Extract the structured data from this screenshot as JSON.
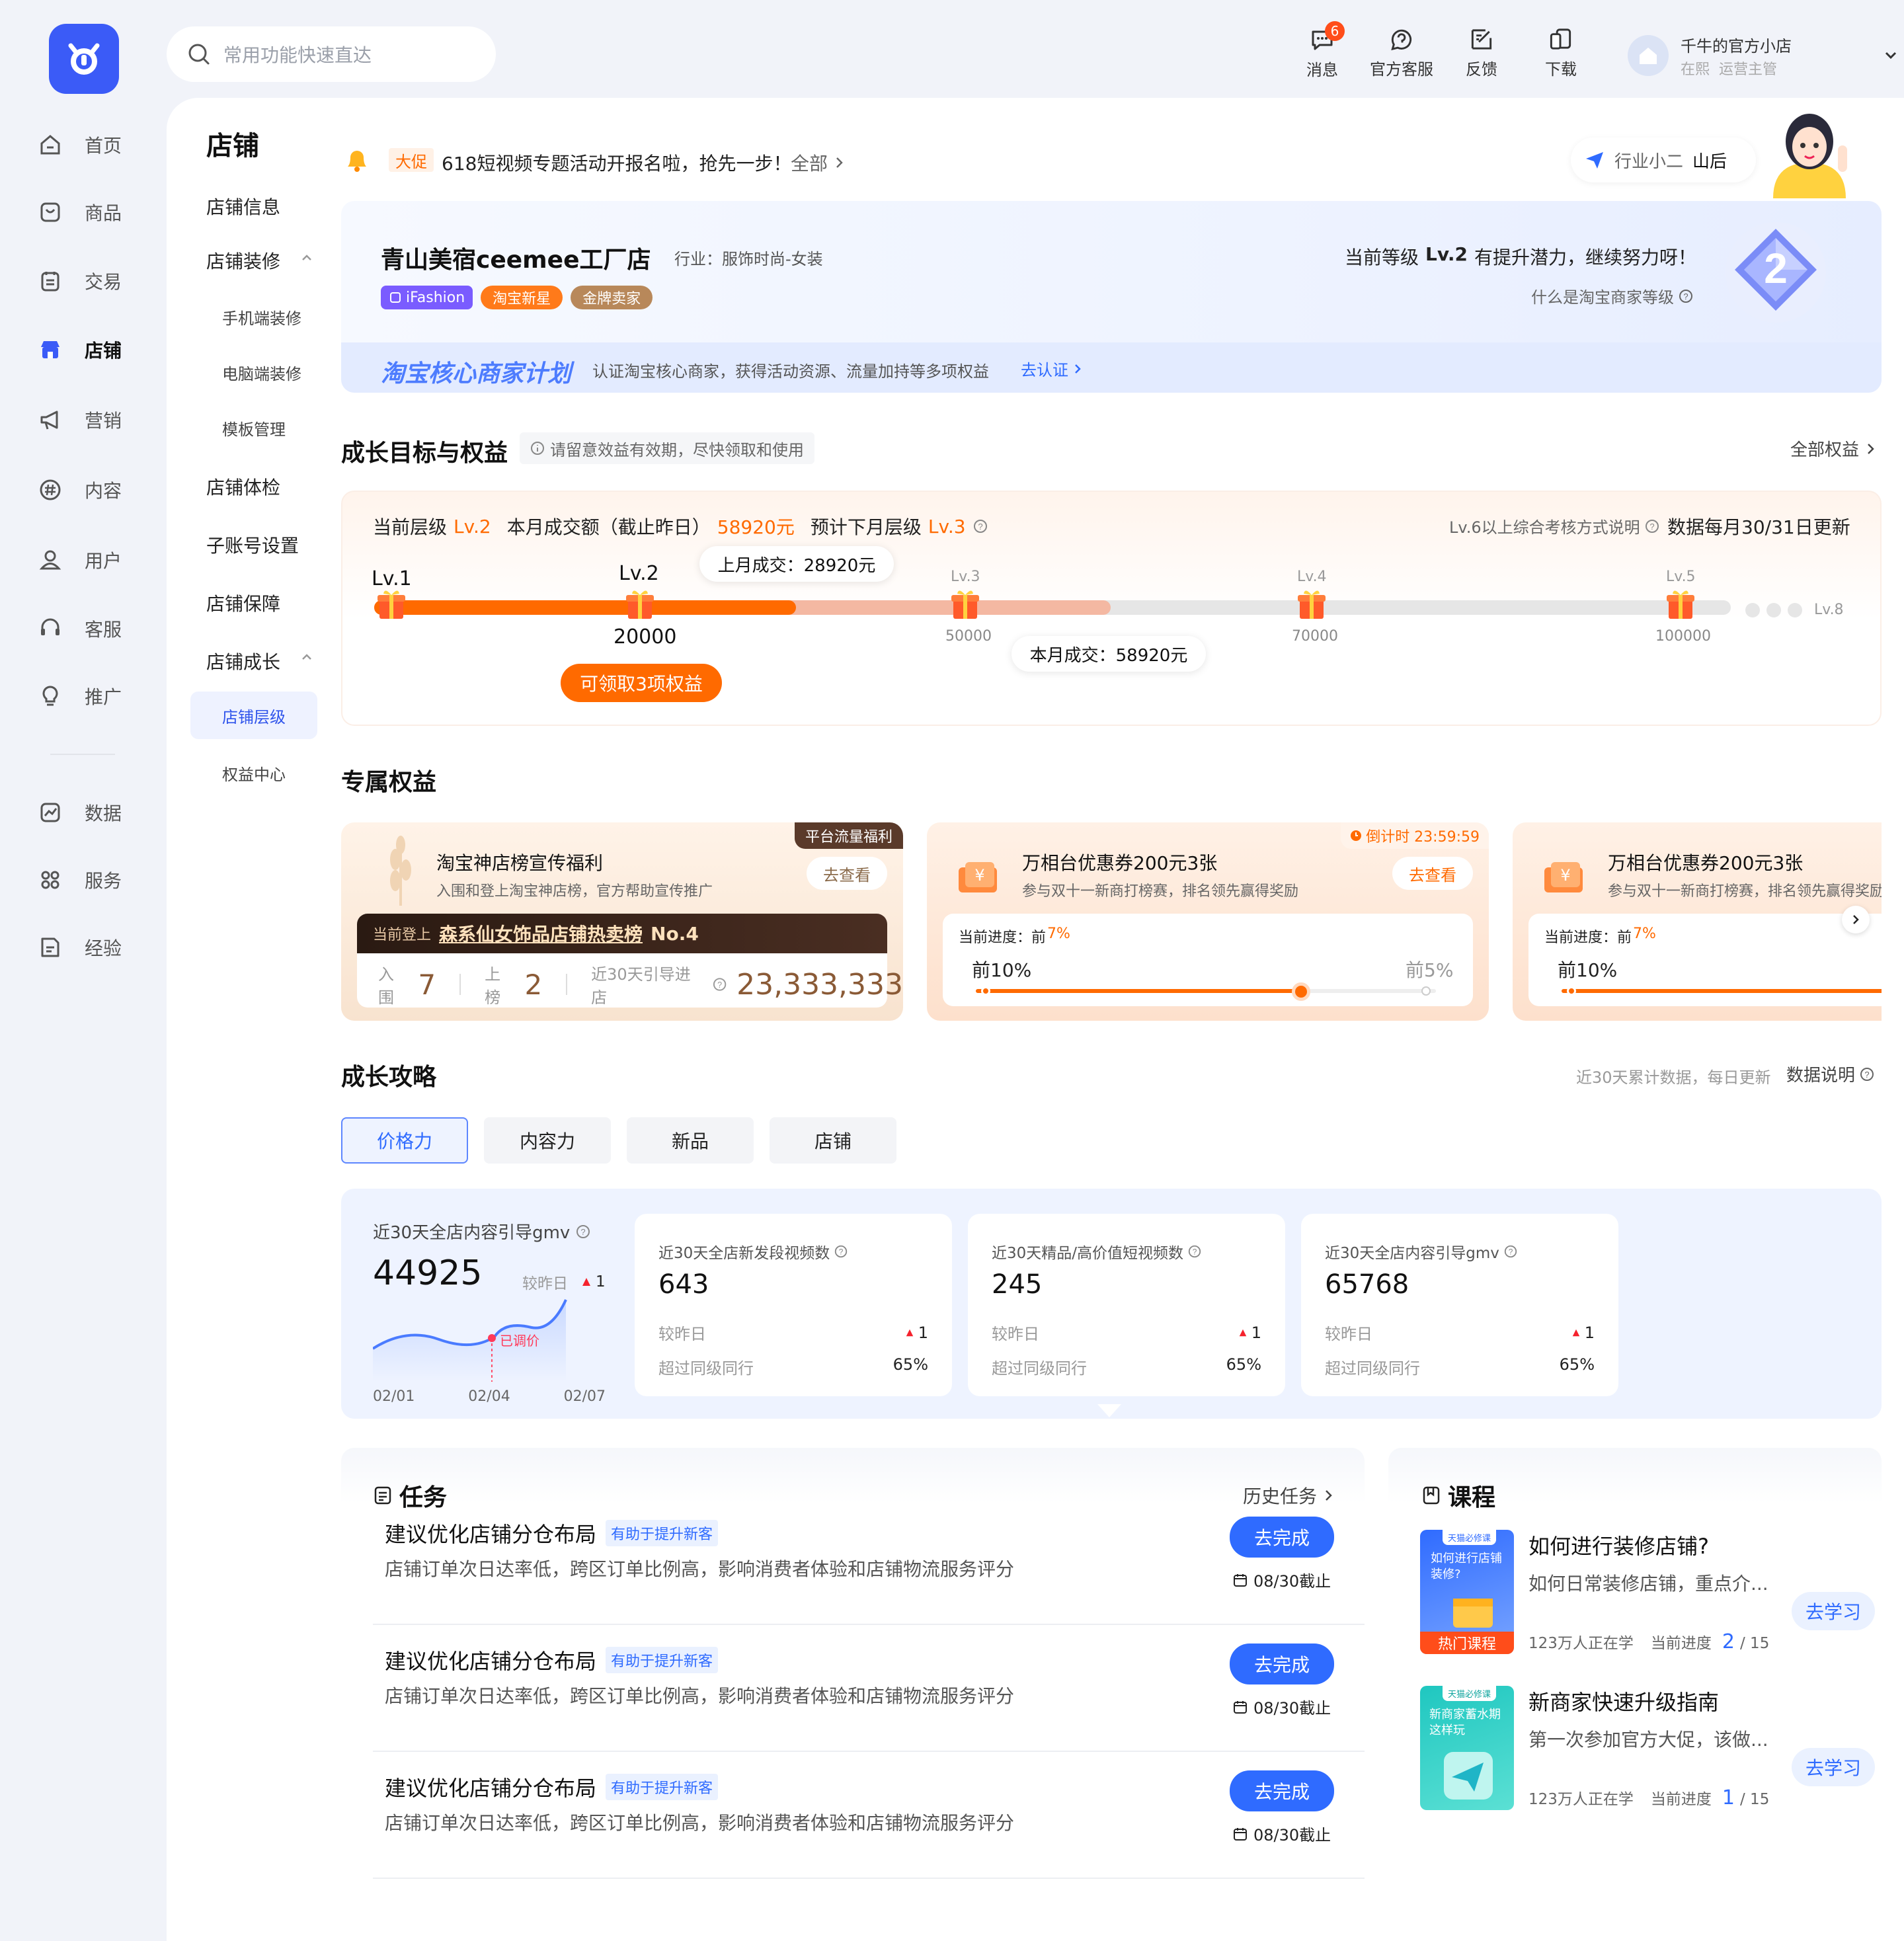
{
  "header": {
    "search_placeholder": "常用功能快速直达",
    "icons": [
      {
        "label": "消息",
        "badge": "6"
      },
      {
        "label": "官方客服"
      },
      {
        "label": "反馈"
      },
      {
        "label": "下载"
      }
    ],
    "user": {
      "name": "千牛的官方小店",
      "status": "在熙",
      "role": "运营主管"
    }
  },
  "sidebar": {
    "items": [
      {
        "label": "首页"
      },
      {
        "label": "商品"
      },
      {
        "label": "交易"
      },
      {
        "label": "店铺"
      },
      {
        "label": "营销"
      },
      {
        "label": "内容"
      },
      {
        "label": "用户"
      },
      {
        "label": "客服"
      },
      {
        "label": "推广"
      },
      {
        "label": "数据"
      },
      {
        "label": "服务"
      },
      {
        "label": "经验"
      }
    ],
    "active": "店铺"
  },
  "subnav": {
    "title": "店铺",
    "items": [
      "店铺信息",
      "店铺装修",
      "手机端装修",
      "电脑端装修",
      "模板管理",
      "店铺体检",
      "子账号设置",
      "店铺保障",
      "店铺成长",
      "店铺层级",
      "权益中心"
    ]
  },
  "notice": {
    "tag": "大促",
    "text": "618短视频专题活动开报名啦，抢先一步！",
    "link": "全部"
  },
  "assistant": {
    "label": "行业小二",
    "name": "山后"
  },
  "shop": {
    "name": "青山美宿ceemee工厂店",
    "industry": "行业：服饰时尚-女装",
    "tags": [
      "iFashion",
      "淘宝新星",
      "金牌卖家"
    ],
    "level_text_prefix": "当前等级",
    "level": "Lv.2",
    "level_text_suffix": "有提升潜力，继续努力呀！",
    "level_help": "什么是淘宝商家等级",
    "level_badge": "2",
    "plan_title": "淘宝核心商家计划",
    "plan_desc": "认证淘宝核心商家，获得活动资源、流量加持等多项权益",
    "plan_link": "去认证"
  },
  "growth": {
    "title": "成长目标与权益",
    "tip": "请留意效益有效期，尽快领取和使用",
    "all_link": "全部权益",
    "current_label": "当前层级",
    "current_level": "Lv.2",
    "month_label": "本月成交额（截止昨日）",
    "month_amount": "58920元",
    "next_label": "预计下月层级",
    "next_level": "Lv.3",
    "note": "Lv.6以上综合考核方式说明",
    "update": "数据每月30/31日更新",
    "last_month_bubble": "上月成交：28920元",
    "this_month_bubble": "本月成交：58920元",
    "claim_button": "可领取3项权益",
    "levels": [
      {
        "name": "Lv.1",
        "value": ""
      },
      {
        "name": "Lv.2",
        "value": "20000"
      },
      {
        "name": "Lv.3",
        "value": "50000"
      },
      {
        "name": "Lv.4",
        "value": "70000"
      },
      {
        "name": "Lv.5",
        "value": "100000"
      }
    ],
    "end_level": "Lv.8",
    "last_month_value": 28920,
    "this_month_value": 58920
  },
  "benefits": {
    "title": "专属权益",
    "cards": [
      {
        "corner": "平台流量福利",
        "title": "淘宝神店榜宣传福利",
        "desc": "入围和登上淘宝神店榜，官方帮助宣传推广",
        "action": "去查看",
        "rank_prefix": "当前登上",
        "rank_name": "森系仙女饰品店铺热卖榜",
        "rank_no": "No.4",
        "stat1_label": "入围",
        "stat1_value": "7",
        "stat2_label": "上榜",
        "stat2_value": "2",
        "stat3_label": "近30天引导进店",
        "stat3_value": "23,333,333"
      },
      {
        "corner": "倒计时 23:59:59",
        "title": "万相台优惠券200元3张",
        "desc": "参与双十一新商打榜赛，排名领先赢得奖励",
        "action": "去查看",
        "progress_label": "当前进度：前",
        "progress_value": "7%",
        "from": "前10%",
        "to": "前5%"
      },
      {
        "title": "万相台优惠券200元3张",
        "desc": "参与双十一新商打榜赛，排名领先赢得奖励",
        "progress_label": "当前进度：前",
        "progress_value": "7%",
        "from": "前10%"
      }
    ]
  },
  "strategy": {
    "title": "成长攻略",
    "note": "近30天累计数据，每日更新",
    "data_link": "数据说明",
    "tabs": [
      "价格力",
      "内容力",
      "新品",
      "店铺"
    ],
    "main_metric": {
      "label": "近30天全店内容引导gmv",
      "value": "44925",
      "compare": "较昨日",
      "delta": "1",
      "marker": "已调价",
      "x_labels": [
        "02/01",
        "02/04",
        "02/07"
      ]
    },
    "metrics": [
      {
        "label": "近30天全店新发段视频数",
        "value": "643",
        "compare": "较昨日",
        "delta": "1",
        "peer": "超过同级同行",
        "peer_value": "65%"
      },
      {
        "label": "近30天精品/高价值短视频数",
        "value": "245",
        "compare": "较昨日",
        "delta": "1",
        "peer": "超过同级同行",
        "peer_value": "65%"
      },
      {
        "label": "近30天全店内容引导gmv",
        "value": "65768",
        "compare": "较昨日",
        "delta": "1",
        "peer": "超过同级同行",
        "peer_value": "65%"
      }
    ]
  },
  "tasks": {
    "title": "任务",
    "history": "历史任务",
    "items": [
      {
        "title": "建议优化店铺分仓布局",
        "tag": "有助于提升新客",
        "desc": "店铺订单次日达率低，跨区订单比例高，影响消费者体验和店铺物流服务评分",
        "button": "去完成",
        "due": "08/30截止"
      },
      {
        "title": "建议优化店铺分仓布局",
        "tag": "有助于提升新客",
        "desc": "店铺订单次日达率低，跨区订单比例高，影响消费者体验和店铺物流服务评分",
        "button": "去完成",
        "due": "08/30截止"
      },
      {
        "title": "建议优化店铺分仓布局",
        "tag": "有助于提升新客",
        "desc": "店铺订单次日达率低，跨区订单比例高，影响消费者体验和店铺物流服务评分",
        "button": "去完成",
        "due": "08/30截止"
      }
    ]
  },
  "courses": {
    "title": "课程",
    "items": [
      {
        "title": "如何进行装修店铺?",
        "desc": "如何日常装修店铺，重点介...",
        "learners": "123万人正在学",
        "progress_label": "当前进度",
        "progress": "2",
        "total": "/ 15",
        "button": "去学习",
        "thumb_badge": "天猫必修课",
        "thumb_title": "如何进行店铺装修?",
        "thumb_tag": "热门课程"
      },
      {
        "title": "新商家快速升级指南",
        "desc": "第一次参加官方大促，该做...",
        "learners": "123万人正在学",
        "progress_label": "当前进度",
        "progress": "1",
        "total": "/ 15",
        "button": "去学习",
        "thumb_badge": "天猫必修课",
        "thumb_title": "新商家蓄水期这样玩"
      }
    ]
  },
  "colors": {
    "brand": "#3b5bf7",
    "accent": "#ff6a00",
    "link": "#2f6bff"
  }
}
